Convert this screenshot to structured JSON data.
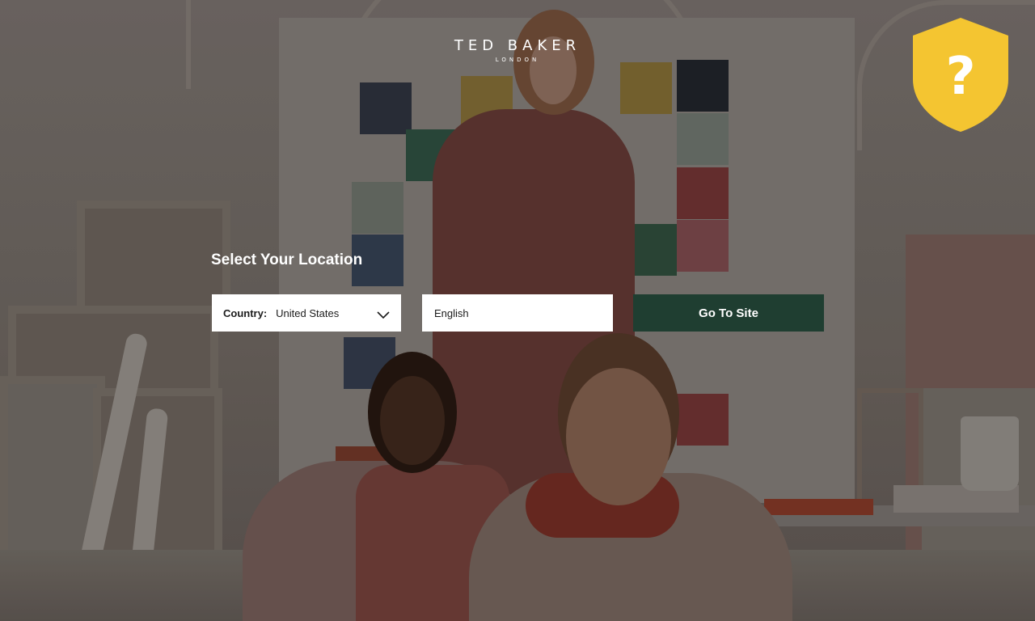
{
  "brand": {
    "name": "TED BAKER",
    "location": "LONDON"
  },
  "help": {
    "glyph": "?",
    "icon": "help-shield-icon",
    "color": "#f4c531"
  },
  "location_selector": {
    "heading": "Select Your Location",
    "country_label": "Country:",
    "country_value": "United States",
    "language_value": "English",
    "go_button_label": "Go To Site",
    "go_button_color": "#1f3e31"
  }
}
